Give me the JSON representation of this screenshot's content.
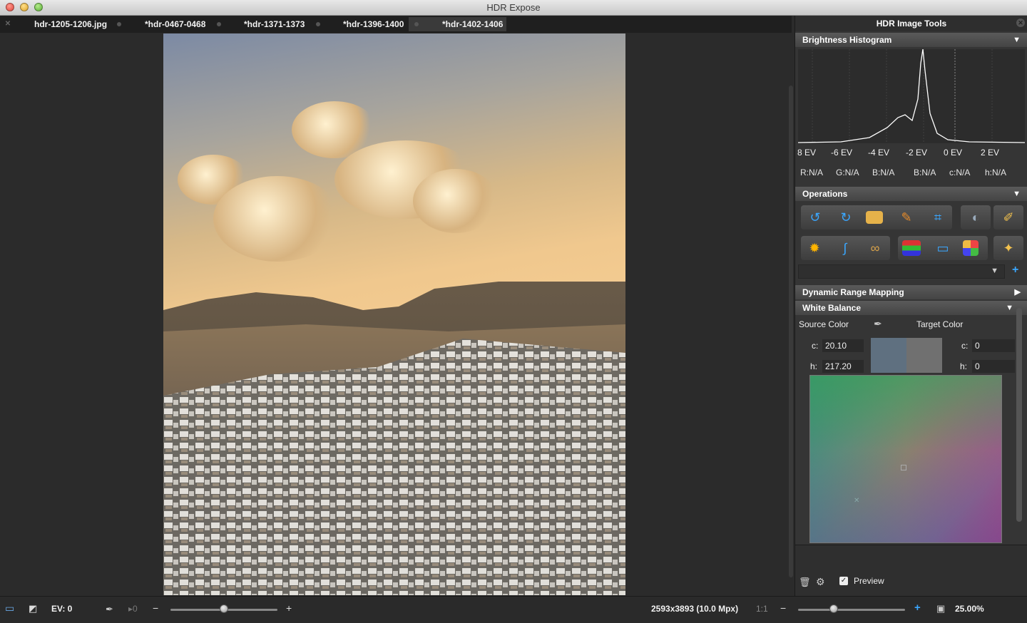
{
  "window": {
    "title": "HDR Expose"
  },
  "tabs": [
    {
      "label": "hdr-1205-1206.jpg",
      "active": false
    },
    {
      "label": "*hdr-0467-0468",
      "active": false
    },
    {
      "label": "*hdr-1371-1373",
      "active": false
    },
    {
      "label": "*hdr-1396-1400",
      "active": false
    },
    {
      "label": "*hdr-1402-1406",
      "active": true
    }
  ],
  "panel": {
    "title": "HDR Image Tools",
    "histogram": {
      "header": "Brightness Histogram",
      "ev_labels": [
        "8 EV",
        "-6 EV",
        "-4 EV",
        "-2 EV",
        "0 EV",
        "2 EV"
      ],
      "readouts": [
        "R:N/A",
        "G:N/A",
        "B:N/A",
        "B:N/A",
        "c:N/A",
        "h:N/A"
      ]
    },
    "operations": {
      "header": "Operations",
      "row1": [
        "rotate-left-icon",
        "rotate-right-icon",
        "resize-icon",
        "straighten-icon",
        "crop-icon",
        "lens-icon",
        "brush-icon"
      ],
      "row2": [
        "sun-icon",
        "curves-icon",
        "glasses-icon",
        "levels-icon",
        "color-balance-icon",
        "color-grid-icon",
        "magic-wand-icon"
      ]
    },
    "dynamic_range": {
      "header": "Dynamic Range Mapping"
    },
    "white_balance": {
      "header": "White Balance",
      "source_label": "Source Color",
      "target_label": "Target Color",
      "source_c_label": "c:",
      "source_c": "20.10",
      "source_h_label": "h:",
      "source_h": "217.20",
      "target_c_label": "c:",
      "target_c": "0",
      "target_h_label": "h:",
      "target_h": "0"
    },
    "footer": {
      "preview_label": "Preview",
      "preview_checked": true
    }
  },
  "statusbar": {
    "ev": "EV: 0",
    "ev_arrow": "▸0",
    "image_info": "2593x3893 (10.0 Mpx)",
    "ratio": "1:1",
    "zoom": "25.00%",
    "ev_slider_fraction": 0.5,
    "zoom_slider_fraction": 0.33
  },
  "colors": {
    "accent": "#3aa7ff",
    "panel_bg": "#353535",
    "window_bg": "#2b2b2b"
  }
}
